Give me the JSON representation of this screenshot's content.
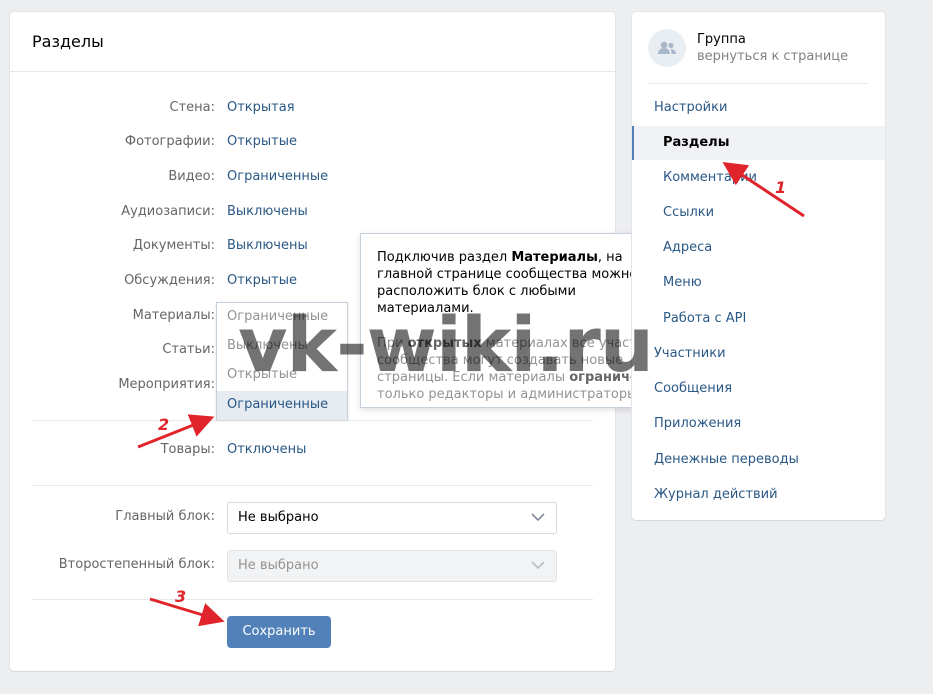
{
  "main": {
    "title": "Разделы",
    "rows": [
      {
        "label": "Стена:",
        "value": "Открытая"
      },
      {
        "label": "Фотографии:",
        "value": "Открытые"
      },
      {
        "label": "Видео:",
        "value": "Ограниченные"
      },
      {
        "label": "Аудиозаписи:",
        "value": "Выключены"
      },
      {
        "label": "Документы:",
        "value": "Выключены"
      },
      {
        "label": "Обсуждения:",
        "value": "Открытые"
      },
      {
        "label": "Материалы:",
        "value": ""
      },
      {
        "label": "Статьи:",
        "value": ""
      },
      {
        "label": "Мероприятия:",
        "value": ""
      }
    ],
    "goods": {
      "label": "Товары:",
      "value": "Отключены"
    },
    "main_block": {
      "label": "Главный блок:",
      "value": "Не выбрано"
    },
    "secondary_block": {
      "label": "Второстепенный блок:",
      "value": "Не выбрано"
    },
    "save_label": "Сохранить"
  },
  "dropdown": {
    "options": [
      "Ограниченные",
      "Выключены",
      "Открытые",
      "Ограниченные"
    ],
    "selected_index": 3
  },
  "tooltip": {
    "p1_a": "Подключив раздел ",
    "p1_b": "Материалы",
    "p1_c": ", на главной странице сообщества можно расположить блок с любыми материалами.",
    "p2_a": "При ",
    "p2_b": "открытых",
    "p2_c": " материалах все участники сообщества могут создавать новые страницы. Если материалы ",
    "p2_d": "ограничены",
    "p2_e": " – только редакторы и администраторы."
  },
  "sidebar": {
    "group_title": "Группа",
    "group_sub": "вернуться к странице",
    "items": [
      {
        "label": "Настройки",
        "sub": false,
        "active": false
      },
      {
        "label": "Разделы",
        "sub": true,
        "active": true
      },
      {
        "label": "Комментарии",
        "sub": true,
        "active": false
      },
      {
        "label": "Ссылки",
        "sub": true,
        "active": false
      },
      {
        "label": "Адреса",
        "sub": true,
        "active": false
      },
      {
        "label": "Меню",
        "sub": true,
        "active": false
      },
      {
        "label": "Работа с API",
        "sub": true,
        "active": false
      },
      {
        "label": "Участники",
        "sub": false,
        "active": false
      },
      {
        "label": "Сообщения",
        "sub": false,
        "active": false
      },
      {
        "label": "Приложения",
        "sub": false,
        "active": false
      },
      {
        "label": "Денежные переводы",
        "sub": false,
        "active": false
      },
      {
        "label": "Журнал действий",
        "sub": false,
        "active": false
      }
    ]
  },
  "annotations": {
    "n1": "1",
    "n2": "2",
    "n3": "3",
    "watermark": "vk-wiki.ru"
  },
  "colors": {
    "accent": "#5181b8",
    "link": "#2a5885",
    "arrow": "#e0242b"
  },
  "icons": {
    "avatar": "group-icon",
    "select": "chevron-down-icon"
  }
}
